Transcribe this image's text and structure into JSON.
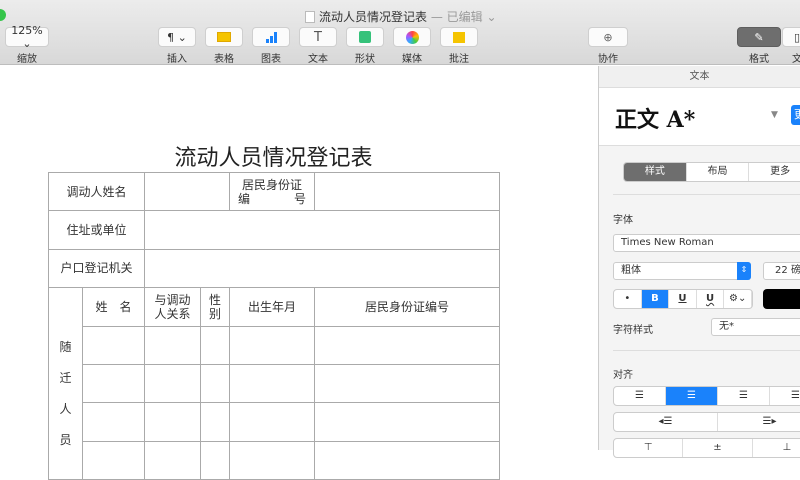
{
  "window": {
    "title": "流动人员情况登记表",
    "status": "— 已编辑 ⌄"
  },
  "toolbar": {
    "zoom": {
      "value": "125% ⌄",
      "label": "缩放"
    },
    "insert": {
      "icon": "¶ ⌄",
      "label": "插入"
    },
    "table": {
      "label": "表格"
    },
    "chart": {
      "label": "图表"
    },
    "text": {
      "icon": "T",
      "label": "文本"
    },
    "shape": {
      "label": "形状"
    },
    "media": {
      "label": "媒体"
    },
    "comment": {
      "label": "批注"
    },
    "collab": {
      "label": "协作"
    },
    "format": {
      "label": "格式"
    },
    "document": {
      "label": "文"
    }
  },
  "document": {
    "heading": "流动人员情况登记表",
    "row1": {
      "name_label": "调动人姓名",
      "id_label_1": "居民身份证",
      "id_label_2a": "编",
      "id_label_2b": "号"
    },
    "row2": {
      "label": "住址或单位"
    },
    "row3": {
      "label": "户口登记机关"
    },
    "family": {
      "side": [
        "随",
        "迁",
        "人",
        "员"
      ],
      "headers": [
        "姓　名",
        "与调动人关系",
        "性别",
        "出生年月",
        "居民身份证编号"
      ]
    }
  },
  "sidebar": {
    "header": "文本",
    "paragraph_style": "正文 A*",
    "update": "更",
    "tabs": [
      "样式",
      "布局",
      "更多"
    ],
    "font_label": "字体",
    "font": "Times New Roman",
    "typeface": "粗体",
    "size": "22 磅",
    "format_buttons": [
      "•",
      "B",
      "U",
      "U",
      "⚙⌄"
    ],
    "char_style_label": "字符样式",
    "char_style": "无*",
    "align_label": "对齐"
  },
  "colors": {
    "accent": "#1a82fb",
    "text_color": "#000000"
  }
}
